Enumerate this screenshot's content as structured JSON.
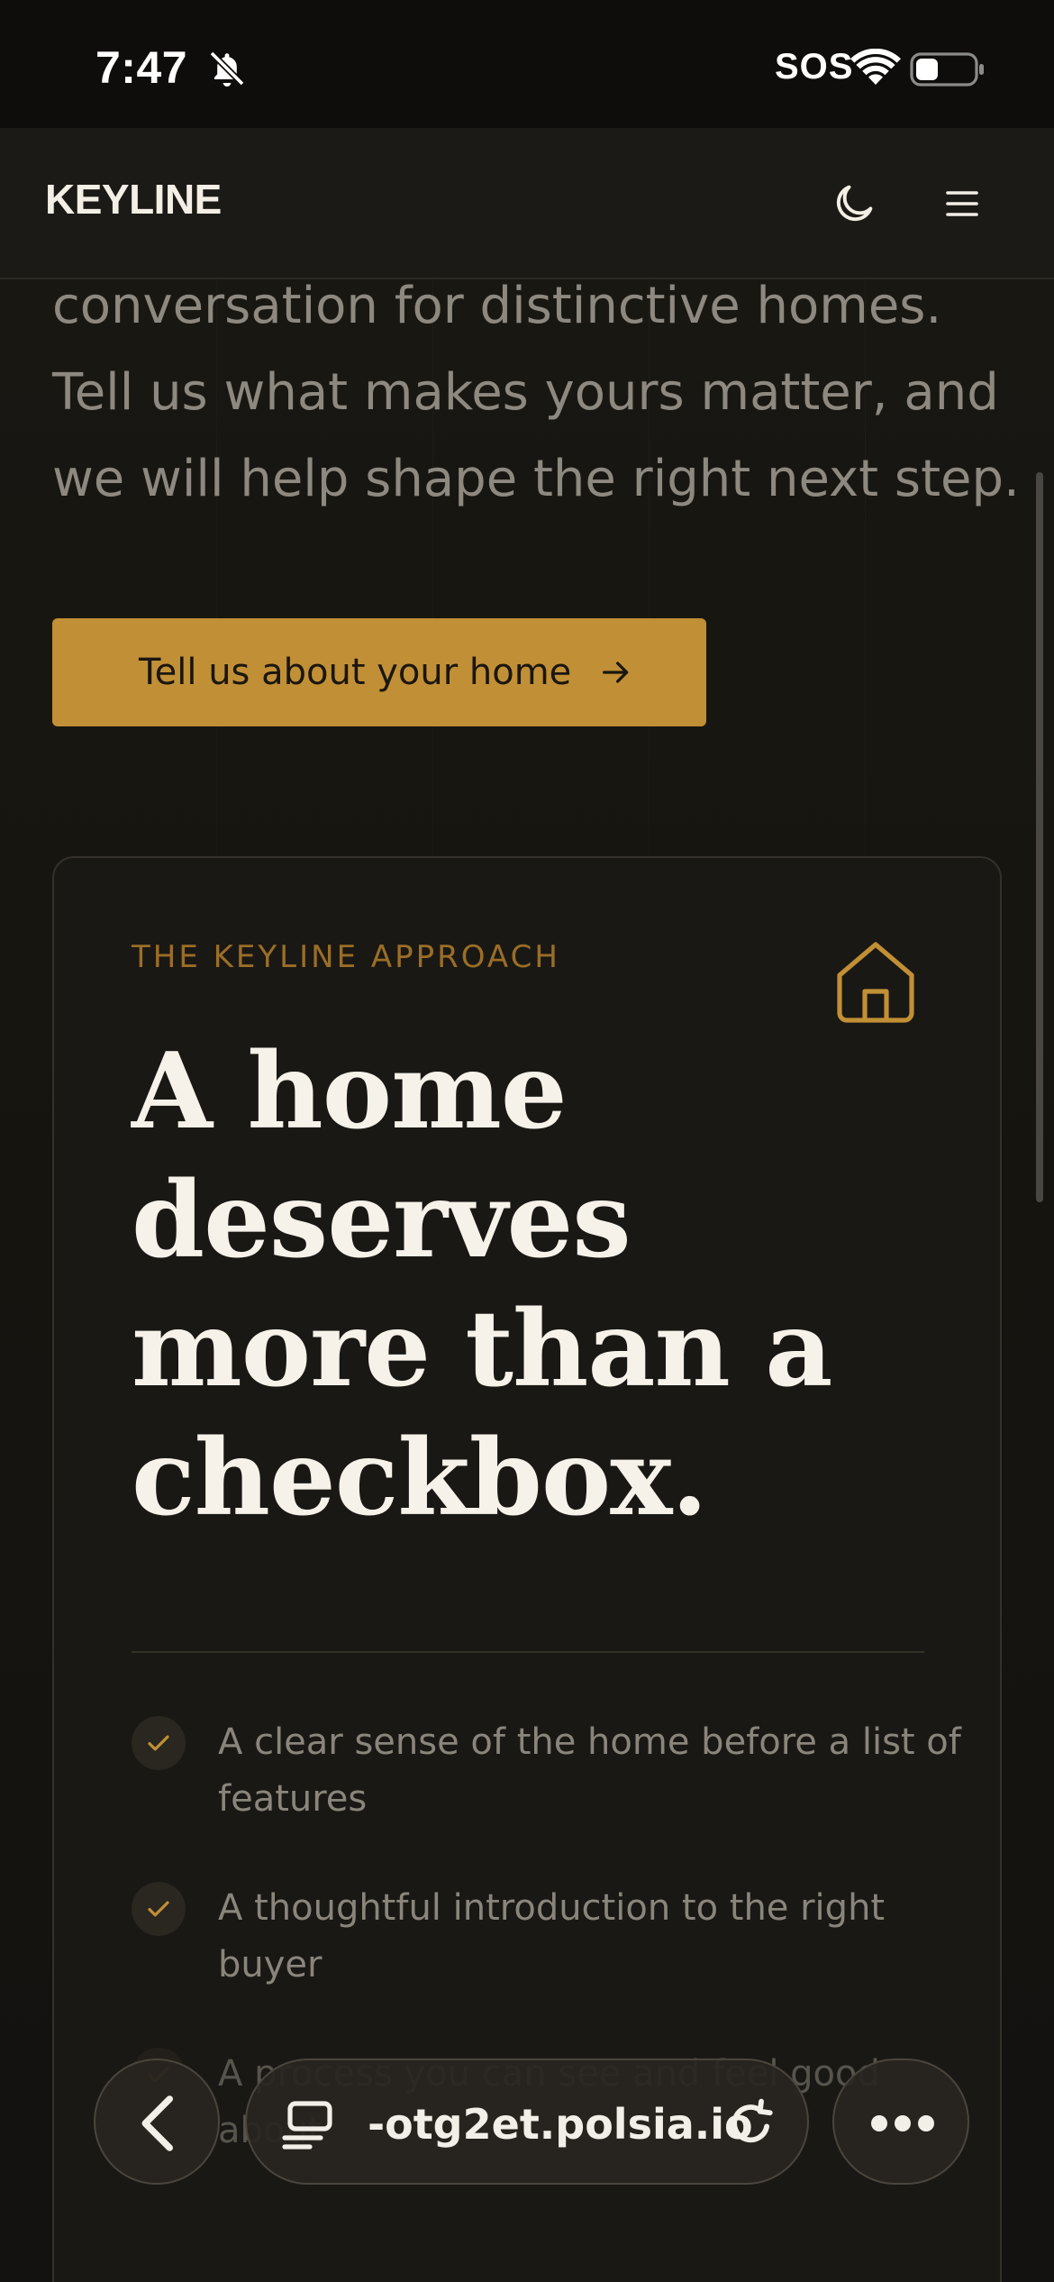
{
  "status_bar": {
    "time": "7:47",
    "carrier": "SOS",
    "icons": [
      "bell-slash-icon",
      "wifi-icon",
      "battery-icon"
    ]
  },
  "nav": {
    "logo": "KEYLINE",
    "icons": [
      "moon-icon",
      "menu-icon"
    ]
  },
  "hero": {
    "lines": [
      "conversation for distinctive homes.",
      "Tell us what makes yours matter, and",
      "we will help shape the right next step."
    ],
    "cta_label": "Tell us about your home"
  },
  "card": {
    "eyebrow": "THE KEYLINE APPROACH",
    "headline_lines": [
      "A home",
      "deserves",
      "more than a",
      "checkbox."
    ],
    "features": [
      "A clear sense of the home before a list of features",
      "A thoughtful introduction to the right buyer",
      "A process you can see and feel good about"
    ]
  },
  "browser": {
    "url": "-otg2et.polsia.io"
  },
  "colors": {
    "accent": "#c18f35",
    "eyebrow": "#9a6e27",
    "background": "#171511",
    "headline": "#f6f2ea",
    "body_text": "#8d8880"
  }
}
